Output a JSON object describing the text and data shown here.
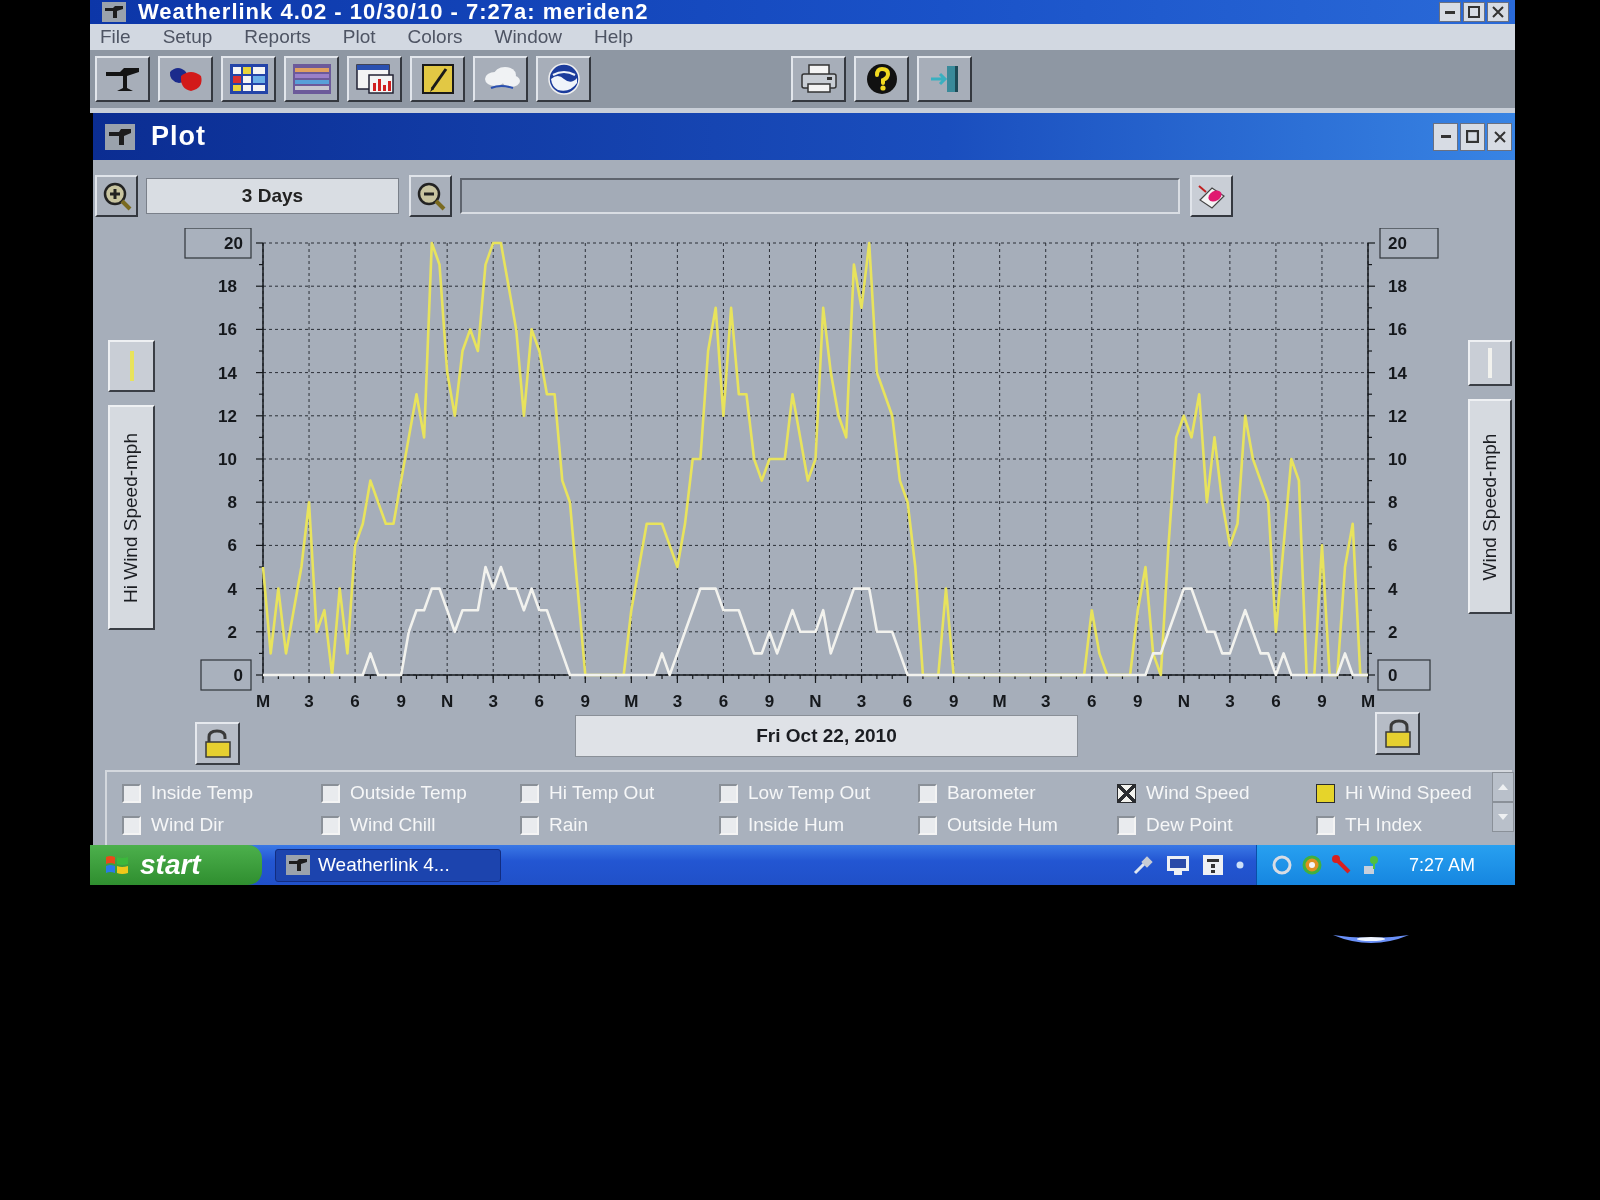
{
  "main_window": {
    "title": "Weatherlink 4.02 - 10/30/10 - 7:27a: meriden2"
  },
  "menu": [
    "File",
    "Setup",
    "Reports",
    "Plot",
    "Colors",
    "Window",
    "Help"
  ],
  "plot_window": {
    "title": "Plot",
    "range": "3 Days",
    "chart_data": {
      "type": "line",
      "ylabel": "Hi Wind Speed-mph",
      "grid": true,
      "categories": [
        "M",
        null,
        null,
        null,
        null,
        null,
        "3",
        null,
        null,
        null,
        null,
        null,
        "6",
        null,
        null,
        null,
        null,
        null,
        "9",
        null,
        null,
        null,
        null,
        null,
        "N",
        null,
        null,
        null,
        null,
        null,
        "3",
        null,
        null,
        null,
        null,
        null,
        "6",
        null,
        null,
        null,
        null,
        null,
        "9",
        null,
        null,
        null,
        null,
        null,
        "M",
        null,
        null,
        null,
        null,
        null,
        "3",
        null,
        null,
        null,
        null,
        null,
        "6",
        null,
        null,
        null,
        null,
        null,
        "9",
        null,
        null,
        null,
        null,
        null,
        "N",
        null,
        null,
        null,
        null,
        null,
        "3",
        null,
        null,
        null,
        null,
        null,
        "6",
        null,
        null,
        null,
        null,
        null,
        "9",
        null,
        null,
        null,
        null,
        null,
        "M",
        null,
        null,
        null,
        null,
        null,
        "3",
        null,
        null,
        null,
        null,
        null,
        "6",
        null,
        null,
        null,
        null,
        null,
        "9",
        null,
        null,
        null,
        null,
        null,
        "N",
        null,
        null,
        null,
        null,
        null,
        "3",
        null,
        null,
        null,
        null,
        null,
        "6",
        null,
        null,
        null,
        null,
        null,
        "9",
        null,
        null,
        null,
        null,
        null,
        "M"
      ],
      "series": [
        {
          "color": "#e8e35c",
          "values": [
            5,
            1,
            4,
            1,
            3,
            5,
            8,
            2,
            3,
            0,
            4,
            1,
            6,
            7,
            9,
            8,
            7,
            7,
            9,
            11,
            13,
            11,
            20,
            19,
            14,
            12,
            15,
            16,
            15,
            19,
            20,
            20,
            18,
            16,
            12,
            16,
            15,
            13,
            13,
            9,
            8,
            4,
            0,
            0,
            0,
            0,
            0,
            0,
            3,
            5,
            7,
            7,
            7,
            6,
            5,
            7,
            10,
            10,
            15,
            17,
            12,
            17,
            13,
            13,
            10,
            9,
            10,
            10,
            10,
            13,
            11,
            9,
            10,
            17,
            14,
            12,
            11,
            19,
            17,
            20,
            14,
            13,
            12,
            9,
            8,
            5,
            0,
            0,
            0,
            4,
            0,
            0,
            0,
            0,
            0,
            0,
            0,
            0,
            0,
            0,
            0,
            0,
            0,
            0,
            0,
            0,
            0,
            0,
            3,
            1,
            0,
            0,
            0,
            0,
            3,
            5,
            1,
            0,
            6,
            11,
            12,
            11,
            13,
            8,
            11,
            8,
            6,
            7,
            12,
            10,
            9,
            8,
            2,
            6,
            10,
            9,
            0,
            0,
            6,
            0,
            0,
            5,
            7,
            0,
            0
          ]
        },
        {
          "color": "#f2f2ee",
          "values": [
            0,
            0,
            0,
            0,
            0,
            0,
            0,
            0,
            0,
            0,
            0,
            0,
            0,
            0,
            1,
            0,
            0,
            0,
            0,
            2,
            3,
            3,
            4,
            4,
            3,
            2,
            3,
            3,
            3,
            5,
            4,
            5,
            4,
            4,
            3,
            4,
            3,
            3,
            2,
            1,
            0,
            0,
            0,
            0,
            0,
            0,
            0,
            0,
            0,
            0,
            0,
            0,
            1,
            0,
            1,
            2,
            3,
            4,
            4,
            4,
            3,
            3,
            3,
            2,
            1,
            1,
            2,
            1,
            2,
            3,
            2,
            2,
            2,
            3,
            1,
            2,
            3,
            4,
            4,
            4,
            2,
            2,
            2,
            1,
            0,
            0,
            0,
            0,
            0,
            0,
            0,
            0,
            0,
            0,
            0,
            0,
            0,
            0,
            0,
            0,
            0,
            0,
            0,
            0,
            0,
            0,
            0,
            0,
            0,
            0,
            0,
            0,
            0,
            0,
            0,
            0,
            1,
            1,
            2,
            3,
            4,
            4,
            3,
            2,
            2,
            1,
            1,
            2,
            3,
            2,
            1,
            1,
            0,
            1,
            0,
            0,
            0,
            0,
            0,
            0,
            0,
            1,
            0,
            0,
            0
          ]
        }
      ],
      "ylim": [
        0,
        20
      ],
      "yticks": [
        {
          "value": 0,
          "label": "0"
        },
        {
          "value": 2,
          "label": "2"
        },
        {
          "value": 4,
          "label": "4"
        },
        {
          "value": 6,
          "label": "6"
        },
        {
          "value": 8,
          "label": "8"
        },
        {
          "value": 10,
          "label": "10"
        },
        {
          "value": 12,
          "label": "12"
        },
        {
          "value": 14,
          "label": "14"
        },
        {
          "value": 16,
          "label": "16"
        },
        {
          "value": 18,
          "label": "18"
        },
        {
          "value": 20,
          "label": "20"
        }
      ]
    },
    "right_axis": {
      "label": "Wind Speed-mph",
      "ticks": [
        "20",
        "18",
        "16",
        "14",
        "12",
        "10",
        "8",
        "6",
        "4",
        "2",
        "0"
      ]
    },
    "date": "Fri Oct 22, 2010"
  },
  "legend": {
    "items": [
      {
        "label": "Inside Temp",
        "checked": false,
        "selected": false
      },
      {
        "label": "Outside Temp",
        "checked": false,
        "selected": false
      },
      {
        "label": "Hi Temp Out",
        "checked": false,
        "selected": false
      },
      {
        "label": "Low Temp Out",
        "checked": false,
        "selected": false
      },
      {
        "label": "Barometer",
        "checked": false,
        "selected": false
      },
      {
        "label": "Wind Speed",
        "checked": true,
        "selected": true,
        "color": "#f2f2ee"
      },
      {
        "label": "Hi Wind Speed",
        "checked": true,
        "selected": false,
        "color": "#e6d42a"
      },
      {
        "label": "Wind Dir",
        "checked": false,
        "selected": false
      },
      {
        "label": "Wind Chill",
        "checked": false,
        "selected": false
      },
      {
        "label": "Rain",
        "checked": false,
        "selected": false
      },
      {
        "label": "Inside Hum",
        "checked": false,
        "selected": false
      },
      {
        "label": "Outside Hum",
        "checked": false,
        "selected": false
      },
      {
        "label": "Dew Point",
        "checked": false,
        "selected": false
      },
      {
        "label": "TH Index",
        "checked": false,
        "selected": false
      }
    ]
  },
  "taskbar": {
    "start": "start",
    "tasks": [
      {
        "label": "Weatherlink 4...",
        "selected": true
      }
    ],
    "clock": "7:27 AM"
  }
}
